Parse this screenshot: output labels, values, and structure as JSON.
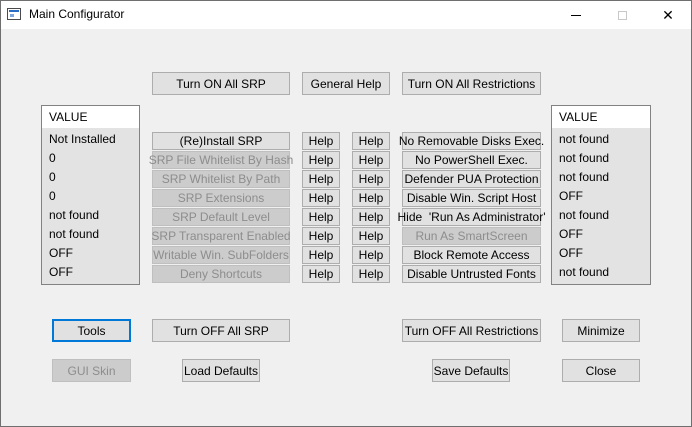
{
  "window": {
    "title": "Main Configurator",
    "controls": {
      "minimize_icon": "minimize-icon",
      "maximize_icon": "maximize-icon",
      "close_glyph": "✕"
    }
  },
  "top_buttons": {
    "turn_on_all_srp": "Turn ON All SRP",
    "general_help": "General Help",
    "turn_on_all_restrictions": "Turn ON All Restrictions"
  },
  "left_list": {
    "header": "VALUE",
    "items": [
      "Not Installed",
      "0",
      "0",
      "0",
      "not found",
      "not found",
      "OFF",
      "OFF"
    ]
  },
  "srp_buttons": [
    {
      "label": "(Re)Install SRP",
      "enabled": true
    },
    {
      "label": "SRP File Whitelist By Hash",
      "enabled": false
    },
    {
      "label": "SRP Whitelist By Path",
      "enabled": false
    },
    {
      "label": "SRP Extensions",
      "enabled": false
    },
    {
      "label": "SRP Default Level",
      "enabled": false
    },
    {
      "label": "SRP Transparent Enabled",
      "enabled": false
    },
    {
      "label": "Writable Win. SubFolders",
      "enabled": false
    },
    {
      "label": "Deny Shortcuts",
      "enabled": false
    }
  ],
  "help_label": "Help",
  "restriction_buttons": [
    {
      "label": "No Removable Disks Exec.",
      "enabled": true
    },
    {
      "label": "No PowerShell Exec.",
      "enabled": true
    },
    {
      "label": "Defender PUA Protection",
      "enabled": true
    },
    {
      "label": "Disable Win. Script Host",
      "enabled": true
    },
    {
      "label": "Hide  'Run As Administrator'",
      "enabled": true
    },
    {
      "label": "Run As SmartScreen",
      "enabled": false
    },
    {
      "label": "Block Remote Access",
      "enabled": true
    },
    {
      "label": "Disable Untrusted Fonts",
      "enabled": true
    }
  ],
  "right_list": {
    "header": "VALUE",
    "items": [
      "not found",
      "not found",
      "not found",
      "OFF",
      "not found",
      "OFF",
      "OFF",
      "not found"
    ]
  },
  "bottom_buttons": {
    "tools": "Tools",
    "turn_off_all_srp": "Turn OFF All SRP",
    "turn_off_all_restrictions": "Turn OFF All Restrictions",
    "minimize": "Minimize",
    "gui_skin": "GUI Skin",
    "load_defaults": "Load Defaults",
    "save_defaults": "Save Defaults",
    "close": "Close"
  }
}
